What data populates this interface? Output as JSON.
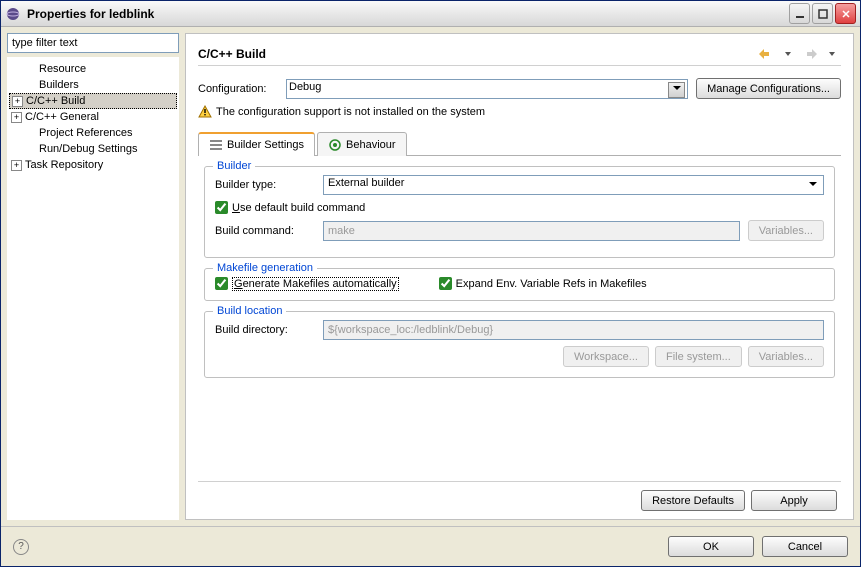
{
  "window": {
    "title": "Properties for ledblink"
  },
  "filter": {
    "placeholder": "type filter text"
  },
  "tree": {
    "items": [
      {
        "label": "Resource",
        "toggle": null
      },
      {
        "label": "Builders",
        "toggle": null
      },
      {
        "label": "C/C++ Build",
        "toggle": "plus",
        "selected": true
      },
      {
        "label": "C/C++ General",
        "toggle": "plus"
      },
      {
        "label": "Project References",
        "toggle": null
      },
      {
        "label": "Run/Debug Settings",
        "toggle": null
      },
      {
        "label": "Task Repository",
        "toggle": "plus"
      }
    ]
  },
  "page": {
    "title": "C/C++ Build"
  },
  "config": {
    "label": "Configuration:",
    "value": "Debug",
    "manage_btn": "Manage Configurations..."
  },
  "warning": {
    "text": "The configuration support is not installed on the system"
  },
  "tabs": {
    "builder_settings": "Builder Settings",
    "behaviour": "Behaviour"
  },
  "builder": {
    "legend": "Builder",
    "type_label": "Builder type:",
    "type_value": "External builder",
    "use_default": "se default build command",
    "use_default_prefix": "U",
    "build_cmd_label": "Build command:",
    "build_cmd_value": "make",
    "variables_btn": "Variables..."
  },
  "makefile": {
    "legend": "Makefile generation",
    "generate": "enerate Makefiles automatically",
    "generate_prefix": "G",
    "expand": "Expand Env. Variable Refs in Makefiles"
  },
  "buildloc": {
    "legend": "Build location",
    "dir_label": "Build directory:",
    "dir_value": "${workspace_loc:/ledblink/Debug}",
    "workspace_btn": "Workspace...",
    "filesystem_btn": "File system...",
    "variables_btn": "Variables..."
  },
  "actions": {
    "restore": "Restore Defaults",
    "apply": "Apply",
    "ok": "OK",
    "cancel": "Cancel"
  }
}
